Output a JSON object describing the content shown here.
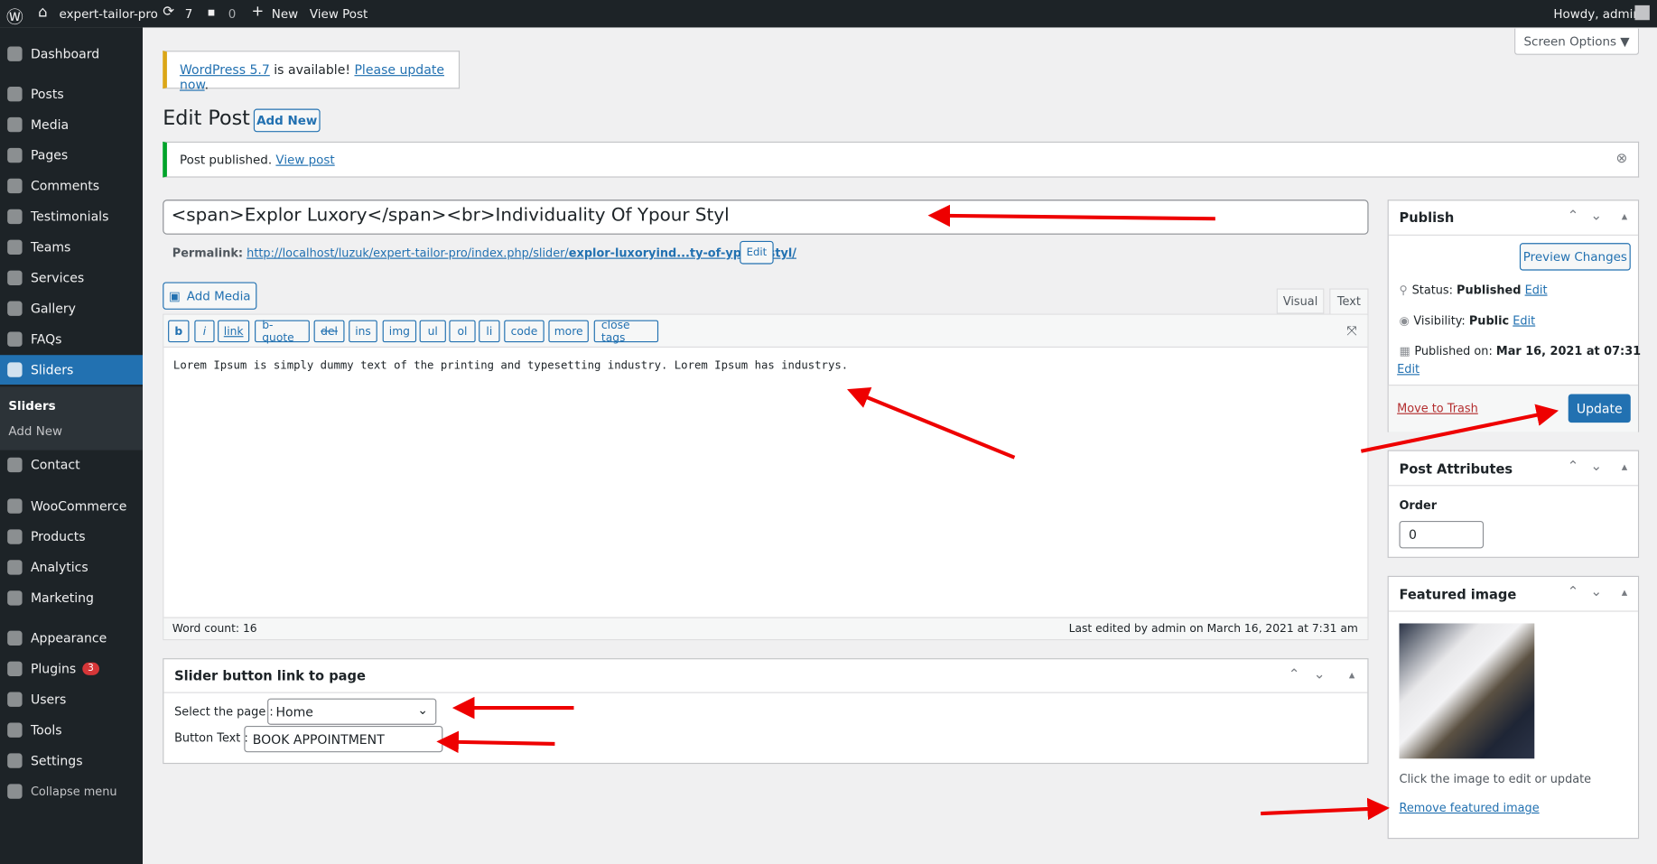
{
  "adminbar": {
    "site": "expert-tailor-pro",
    "updates": "7",
    "comments": "0",
    "new": "New",
    "view_post": "View Post",
    "howdy": "Howdy, admin"
  },
  "sidebar": {
    "items": [
      {
        "label": "Dashboard",
        "icon": "dashboard-icon"
      },
      {
        "label": "Posts",
        "icon": "pin-icon"
      },
      {
        "label": "Media",
        "icon": "media-icon"
      },
      {
        "label": "Pages",
        "icon": "pages-icon"
      },
      {
        "label": "Comments",
        "icon": "comment-icon"
      },
      {
        "label": "Testimonials",
        "icon": "testimonial-icon"
      },
      {
        "label": "Teams",
        "icon": "groups-icon"
      },
      {
        "label": "Services",
        "icon": "services-icon"
      },
      {
        "label": "Gallery",
        "icon": "gallery-icon"
      },
      {
        "label": "FAQs",
        "icon": "faq-icon"
      },
      {
        "label": "Sliders",
        "icon": "slides-icon"
      },
      {
        "label": "Contact",
        "icon": "email-icon"
      },
      {
        "label": "WooCommerce",
        "icon": "woo-icon"
      },
      {
        "label": "Products",
        "icon": "archive-icon"
      },
      {
        "label": "Analytics",
        "icon": "chart-icon"
      },
      {
        "label": "Marketing",
        "icon": "megaphone-icon"
      },
      {
        "label": "Appearance",
        "icon": "brush-icon"
      },
      {
        "label": "Plugins",
        "icon": "plugin-icon",
        "badge": "3"
      },
      {
        "label": "Users",
        "icon": "users-icon"
      },
      {
        "label": "Tools",
        "icon": "wrench-icon"
      },
      {
        "label": "Settings",
        "icon": "settings-icon"
      },
      {
        "label": "Collapse menu",
        "icon": "collapse-icon"
      }
    ],
    "submenu": [
      "Sliders",
      "Add New"
    ]
  },
  "screen_options": "Screen Options ▼",
  "update_notice": {
    "link1": "WordPress 5.7",
    "text": " is available! ",
    "link2": "Please update now",
    "end": "."
  },
  "page_title": "Edit Post",
  "add_new": "Add New",
  "published_notice": {
    "text": "Post published. ",
    "link": "View post"
  },
  "post_title": "<span>Explor Luxory</span><br>Individuality Of Ypour Styl",
  "permalink": {
    "label": "Permalink:",
    "base": "http://localhost/luzuk/expert-tailor-pro/index.php/slider/",
    "slug": "explor-luxoryind...ty-of-ypour-styl/",
    "edit": "Edit"
  },
  "add_media": "Add Media",
  "tabs": [
    "Visual",
    "Text"
  ],
  "quicktags": [
    "b",
    "i",
    "link",
    "b-quote",
    "del",
    "ins",
    "img",
    "ul",
    "ol",
    "li",
    "code",
    "more",
    "close tags"
  ],
  "content": "Lorem Ipsum is simply dummy text of the printing and typesetting industry. Lorem Ipsum has industrys.",
  "word_count": "Word count: 16",
  "last_edited": "Last edited by admin on March 16, 2021 at 7:31 am",
  "slider_box": {
    "title": "Slider button link to page",
    "select_label": "Select the page :",
    "select_value": "Home",
    "button_label": "Button Text :",
    "button_value": "BOOK APPOINTMENT"
  },
  "publish": {
    "title": "Publish",
    "preview": "Preview Changes",
    "status_label": "Status: ",
    "status": "Published",
    "visibility_label": "Visibility: ",
    "visibility": "Public",
    "published_label": "Published on: ",
    "published": "Mar 16, 2021 at 07:31",
    "edit": "Edit",
    "trash": "Move to Trash",
    "update": "Update"
  },
  "attributes": {
    "title": "Post Attributes",
    "order_label": "Order",
    "order": "0"
  },
  "featured": {
    "title": "Featured image",
    "hint": "Click the image to edit or update",
    "remove": "Remove featured image"
  },
  "colors": {
    "accent": "#2271b1",
    "arrow": "#ee0000",
    "sidebar": "#1d2327"
  }
}
